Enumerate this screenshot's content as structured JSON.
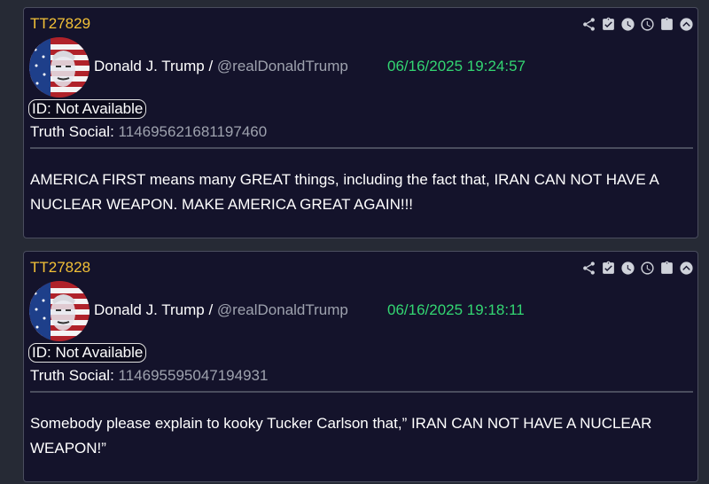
{
  "colors": {
    "background": "#262a35",
    "card": "#14132b",
    "post_id": "#f2c037",
    "timestamp": "#33d672",
    "muted": "#9ea2ae"
  },
  "toolbar_icons": [
    "share-icon",
    "clipboard-check-icon",
    "clock-filled-icon",
    "clock-outline-icon",
    "clipboard-icon",
    "chevron-up-circle-icon"
  ],
  "posts": [
    {
      "id": "TT27829",
      "author_name": "Donald J. Trump",
      "separator": " / ",
      "handle": "@realDonaldTrump",
      "timestamp": "06/16/2025 19:24:57",
      "id_label": "ID: Not Available",
      "truth_social_label": "Truth Social: ",
      "truth_social_id": "114695621681197460",
      "text": "AMERICA FIRST means many GREAT things, including the fact that, IRAN CAN NOT HAVE A NUCLEAR WEAPON. MAKE AMERICA GREAT AGAIN!!!"
    },
    {
      "id": "TT27828",
      "author_name": "Donald J. Trump",
      "separator": " / ",
      "handle": "@realDonaldTrump",
      "timestamp": "06/16/2025 19:18:11",
      "id_label": "ID: Not Available",
      "truth_social_label": "Truth Social: ",
      "truth_social_id": "114695595047194931",
      "text": "Somebody please explain to kooky Tucker Carlson that,” IRAN CAN NOT HAVE A NUCLEAR WEAPON!”"
    }
  ]
}
